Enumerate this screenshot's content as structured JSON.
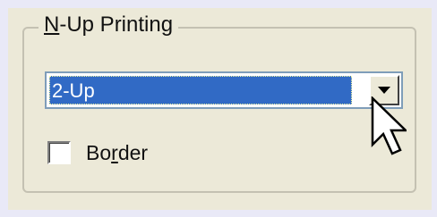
{
  "group": {
    "title_prefix": "N",
    "title_rest": "-Up Printing"
  },
  "combo": {
    "selected": "2-Up",
    "arrow_icon": "chevron-down-icon"
  },
  "border_checkbox": {
    "label_prefix": "Bo",
    "label_underlined": "r",
    "label_rest": "der",
    "checked": false
  },
  "cursor_icon": "arrow-cursor-icon"
}
